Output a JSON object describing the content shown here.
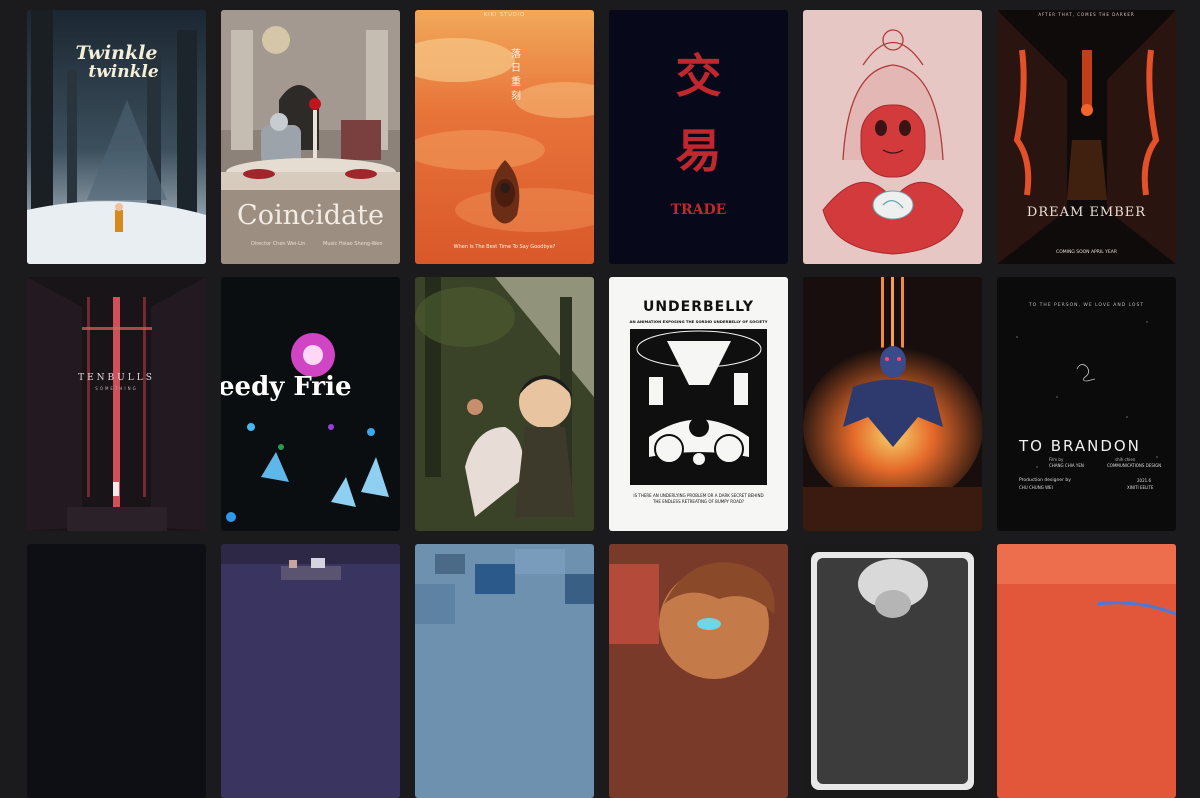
{
  "colors": {
    "page_bg": "#1b1b1d",
    "coincidate_text": "#f2ece4",
    "trade_red": "#c1272d",
    "underbelly_bg": "#f6f6f4"
  },
  "posters": {
    "twinkle": {
      "title_line1": "Twinkle",
      "title_line2": "twinkle"
    },
    "coincidate": {
      "title": "Coincidate",
      "credit_left": "Director  Chen Wei-Lin",
      "credit_right": "Music  Hsiao Sheng-Wen"
    },
    "sunset": {
      "top_tag": "KIKI STUDIO",
      "vertical_title": "落日重刻",
      "tagline": "When Is The Best Time To Say Goodbye?"
    },
    "trade": {
      "char1": "交",
      "char2": "易",
      "en_title": "TRADE"
    },
    "cat": {},
    "dream_ember": {
      "top_tag": "AFTER THAT, COMES THE DARKER",
      "title": "DREAM EMBER",
      "date": "COMING SOON     APRIL YEAR"
    },
    "tenbulls": {
      "title": "TENBULLS",
      "subtitle": "SOMETHING"
    },
    "friend": {
      "title": "eedy Frie"
    },
    "forest": {},
    "underbelly": {
      "title": "UNDERBELLY",
      "subtitle": "AN ANIMATION EXPOSING THE SORDID UNDERBELLY OF SOCIETY",
      "caption": "IS THERE AN UNDERLYING PROBLEM OR A DARK SECRET BEHIND THE ENDLESS RETREATING OF BUMPY ROAD?"
    },
    "fire_figure": {},
    "brandon": {
      "top_line": "TO THE PERSON, WE LOVE AND LOST",
      "title": "TO BRANDON",
      "film_by": "Film by",
      "film_by_name": "CHANG CHIA YEN",
      "school": "shih chien",
      "dept": "COMMUNICATIONS DESIGN",
      "prod_designer": "Production designer by",
      "prod_name": "CHU CHUNG WEI",
      "year": "2021.6",
      "studio": "XINITI EELITE"
    }
  }
}
